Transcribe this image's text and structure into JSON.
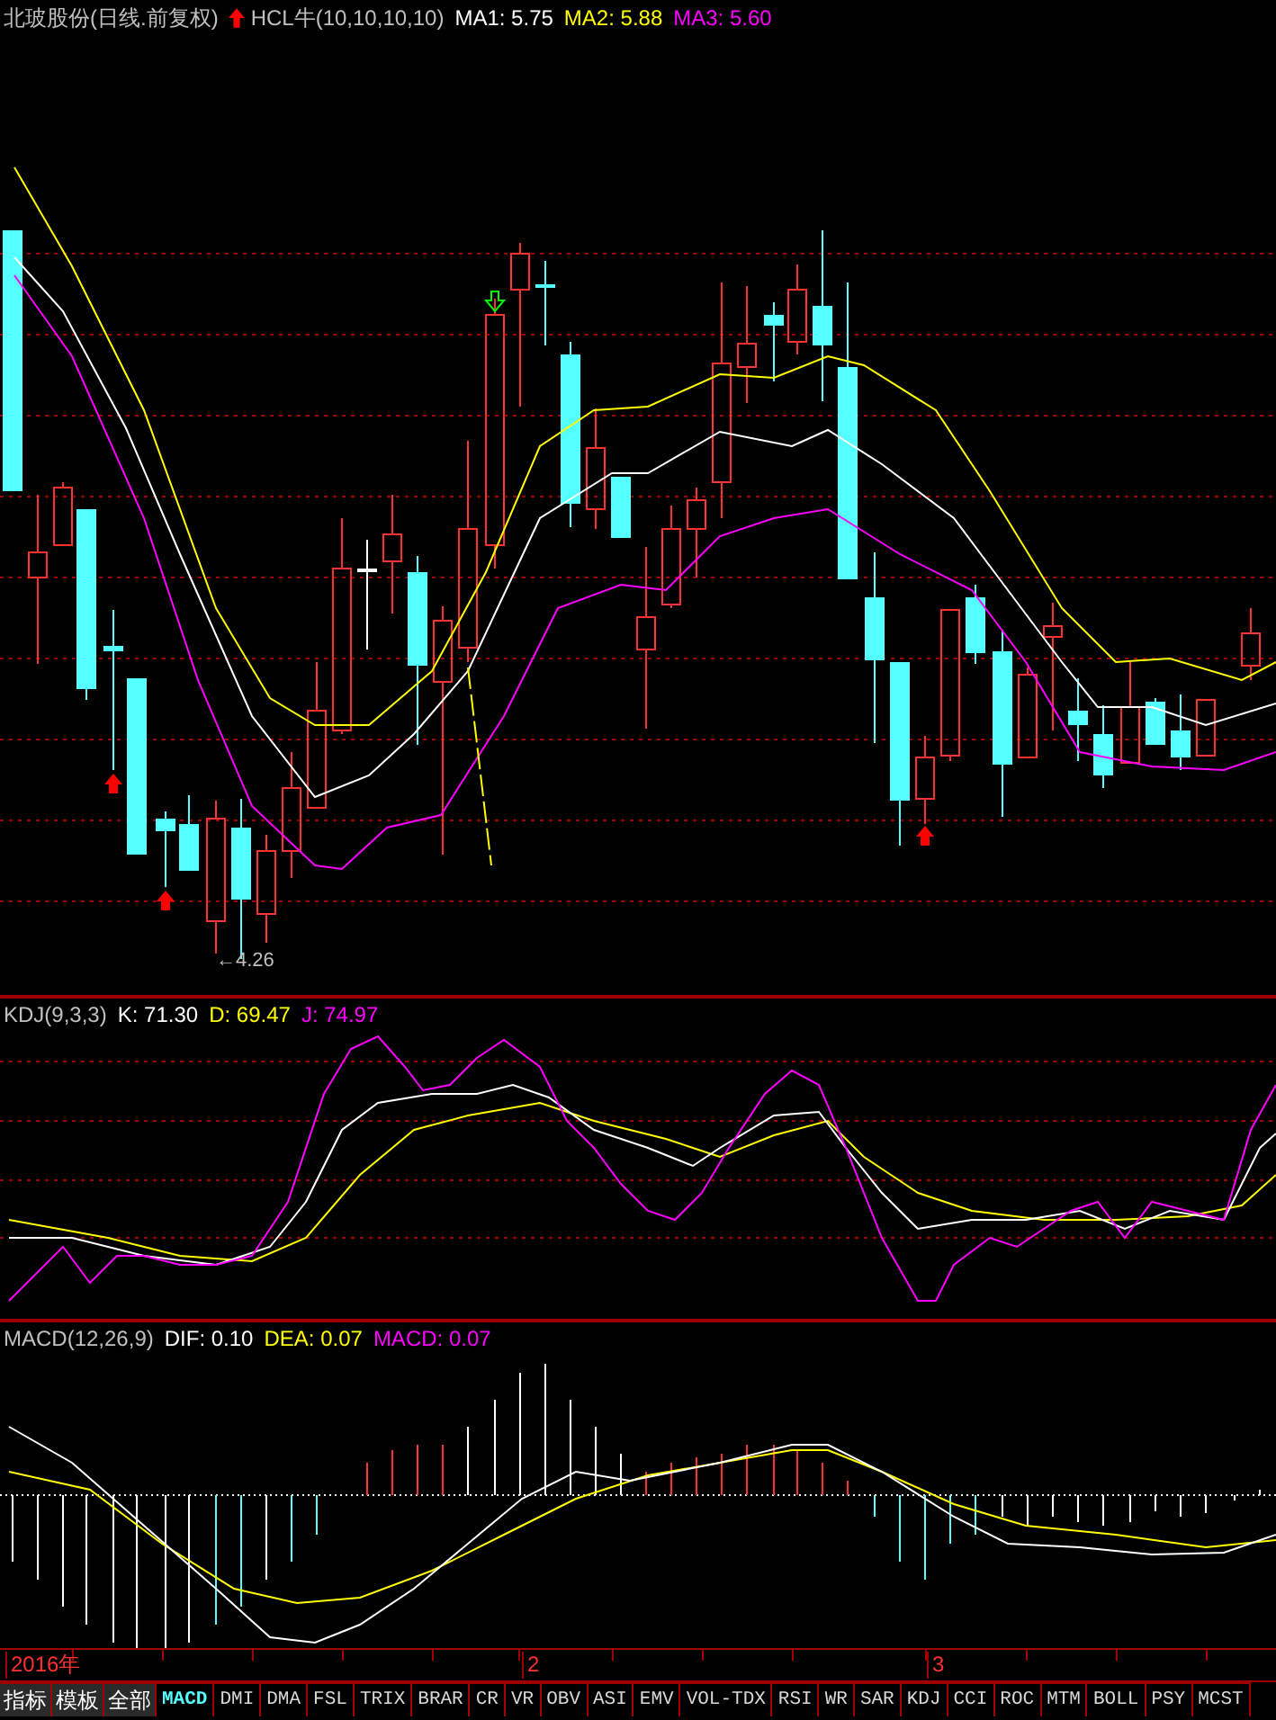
{
  "header": {
    "security": "北玻股份(日线.前复权)",
    "indicator": "HCL牛(10,10,10,10)",
    "values": [
      {
        "label": "MA1: 5.75",
        "color": "#ffffff"
      },
      {
        "label": "MA2: 5.88",
        "color": "#ffff00"
      },
      {
        "label": "MA3: 5.60",
        "color": "#ff00ff"
      }
    ]
  },
  "price_panel": {
    "low_label": "←4.26"
  },
  "kdj_panel": {
    "title": "KDJ(9,3,3)",
    "values": [
      {
        "label": "K: 71.30",
        "color": "#ffffff"
      },
      {
        "label": "D: 69.47",
        "color": "#ffff00"
      },
      {
        "label": "J: 74.97",
        "color": "#ff00ff"
      }
    ]
  },
  "macd_panel": {
    "title": "MACD(12,26,9)",
    "values": [
      {
        "label": "DIF: 0.10",
        "color": "#ffffff"
      },
      {
        "label": "DEA: 0.07",
        "color": "#ffff00"
      },
      {
        "label": "MACD: 0.07",
        "color": "#ff00ff"
      }
    ]
  },
  "date_axis": [
    "2016年",
    "2",
    "3"
  ],
  "tabs": [
    {
      "label": "指标",
      "kind": "menu",
      "selected": false
    },
    {
      "label": "模板",
      "kind": "menu",
      "selected": false
    },
    {
      "label": "全部",
      "kind": "menu",
      "selected": false
    },
    {
      "label": "MACD",
      "kind": "tab",
      "selected": true
    },
    {
      "label": "DMI",
      "kind": "tab",
      "selected": false
    },
    {
      "label": "DMA",
      "kind": "tab",
      "selected": false
    },
    {
      "label": "FSL",
      "kind": "tab",
      "selected": false
    },
    {
      "label": "TRIX",
      "kind": "tab",
      "selected": false
    },
    {
      "label": "BRAR",
      "kind": "tab",
      "selected": false
    },
    {
      "label": "CR",
      "kind": "tab",
      "selected": false
    },
    {
      "label": "VR",
      "kind": "tab",
      "selected": false
    },
    {
      "label": "OBV",
      "kind": "tab",
      "selected": false
    },
    {
      "label": "ASI",
      "kind": "tab",
      "selected": false
    },
    {
      "label": "EMV",
      "kind": "tab",
      "selected": false
    },
    {
      "label": "VOL-TDX",
      "kind": "tab",
      "selected": false
    },
    {
      "label": "RSI",
      "kind": "tab",
      "selected": false
    },
    {
      "label": "WR",
      "kind": "tab",
      "selected": false
    },
    {
      "label": "SAR",
      "kind": "tab",
      "selected": false
    },
    {
      "label": "KDJ",
      "kind": "tab",
      "selected": false
    },
    {
      "label": "CCI",
      "kind": "tab",
      "selected": false
    },
    {
      "label": "ROC",
      "kind": "tab",
      "selected": false
    },
    {
      "label": "MTM",
      "kind": "tab",
      "selected": false
    },
    {
      "label": "BOLL",
      "kind": "tab",
      "selected": false
    },
    {
      "label": "PSY",
      "kind": "tab",
      "selected": false
    },
    {
      "label": "MCST",
      "kind": "tab",
      "selected": false
    }
  ]
}
